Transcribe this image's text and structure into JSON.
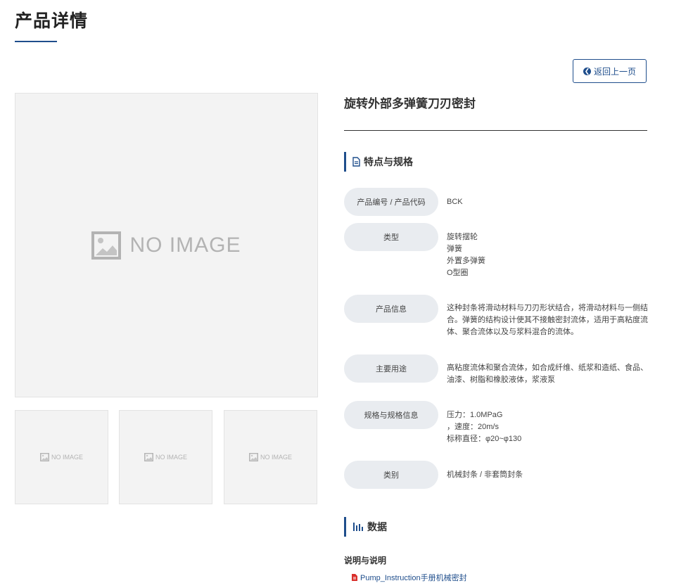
{
  "page": {
    "title": "产品详情"
  },
  "back_button": {
    "label": "返回上一页"
  },
  "gallery": {
    "main": {
      "placeholder_text": "NO IMAGE"
    },
    "thumbs": [
      {
        "placeholder_text": "NO IMAGE"
      },
      {
        "placeholder_text": "NO IMAGE"
      },
      {
        "placeholder_text": "NO IMAGE"
      }
    ]
  },
  "product": {
    "name": "旋转外部多弹簧刀刃密封"
  },
  "features": {
    "heading": "特点与规格",
    "rows": [
      {
        "label": "产品编号 / 产品代码",
        "value": "BCK"
      },
      {
        "label": "类型",
        "value": "旋转摆轮\n弹簧\n外置多弹簧\nO型圈"
      },
      {
        "label": "产品信息",
        "value": "这种封条将滑动材料与刀刃形状结合，将滑动材料与一侧结合。弹簧的结构设计使其不接触密封流体，适用于高粘度流体、聚合流体以及与浆料混合的流体。"
      },
      {
        "label": "主要用途",
        "value": "高粘度流体和聚合流体，如合成纤维、纸浆和造纸、食品、油漆、树脂和橡胶液体，浆液泵"
      },
      {
        "label": "规格与规格信息",
        "value": "压力：1.0MPaG\n，速度：20m/s\n标称直径：φ20~φ130"
      },
      {
        "label": "类别",
        "value": "机械封条 / 非套筒封条"
      }
    ]
  },
  "data_section": {
    "heading": "数据",
    "docs_label": "说明与说明",
    "link": "Pump_Instruction手册机械密封"
  },
  "colors": {
    "accent": "#1f4e8c",
    "pill_bg": "#e9ecf0",
    "placeholder_bg": "#f3f3f3",
    "pdf_red": "#d9302c"
  }
}
